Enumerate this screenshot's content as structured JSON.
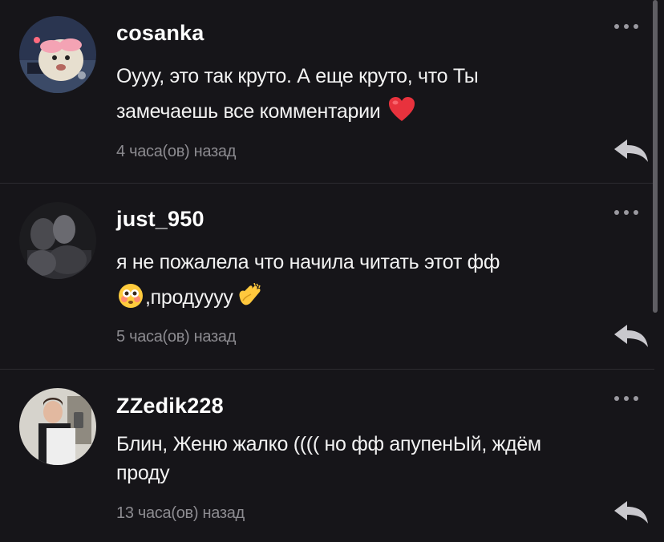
{
  "comments": [
    {
      "username": "cosanka",
      "text_line1": "Оууу, это так круто. А еще круто, что Ты",
      "text_line2": "замечаешь все комментарии",
      "emoji_after": "red-heart",
      "time": "4 часа(ов) назад"
    },
    {
      "username": "just_950",
      "text_line1": "я не пожалела что начила читать этот фф",
      "text_line2": ",продуууу",
      "emoji_before": "flushed-face",
      "emoji_after": "clapping-hands",
      "time": "5 часа(ов) назад"
    },
    {
      "username": "ZZedik228",
      "text_line1": "Блин, Женю жалко (((( но фф апупенЫй, ждём",
      "text_line2": "проду",
      "time": "13 часа(ов) назад"
    }
  ],
  "icons": {
    "more": "more-dots-icon",
    "reply": "reply-arrow-icon"
  },
  "colors": {
    "background": "#161519",
    "text": "#f2f2f2",
    "muted": "#8c8b90",
    "divider": "#2c2b30"
  }
}
